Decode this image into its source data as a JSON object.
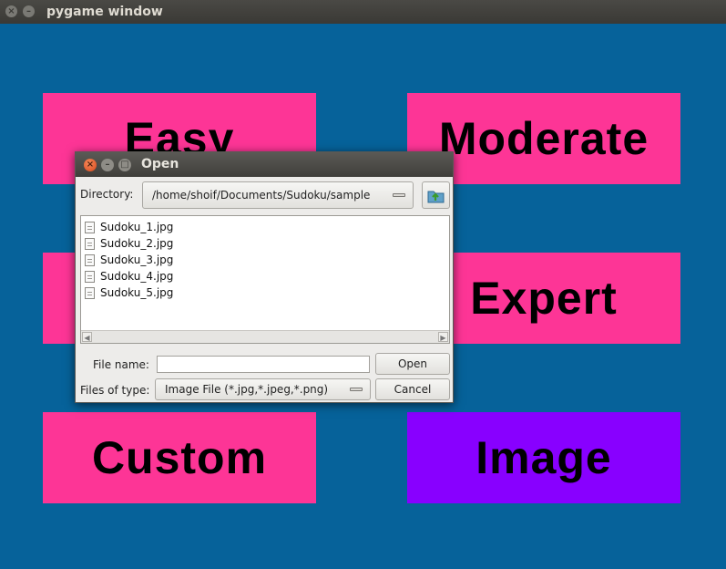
{
  "window": {
    "title": "pygame window"
  },
  "menu": {
    "easy": "Easy",
    "moderate": "Moderate",
    "hard": "",
    "expert": "Expert",
    "custom": "Custom",
    "image": "Image"
  },
  "dialog": {
    "title": "Open",
    "directory_label": "Directory:",
    "directory_value": "/home/shoif/Documents/Sudoku/sample",
    "files": [
      "Sudoku_1.jpg",
      "Sudoku_2.jpg",
      "Sudoku_3.jpg",
      "Sudoku_4.jpg",
      "Sudoku_5.jpg"
    ],
    "filename_label": "File name:",
    "filename_value": "",
    "filetype_label": "Files of type:",
    "filetype_value": "Image File (*.jpg,*.jpeg,*.png)",
    "open_button": "Open",
    "cancel_button": "Cancel"
  },
  "colors": {
    "background": "#06629a",
    "button": "#fd3596",
    "image_button": "#8800ff"
  }
}
